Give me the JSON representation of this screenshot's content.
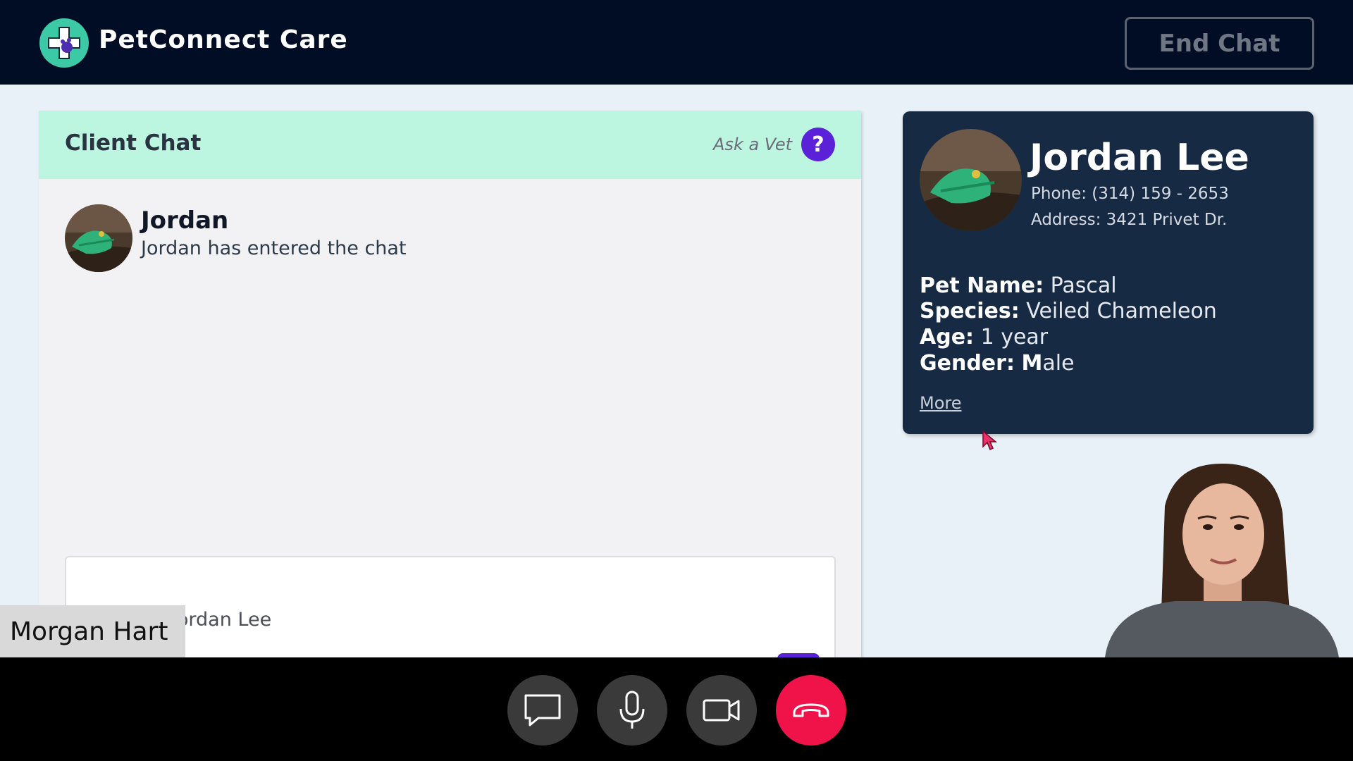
{
  "header": {
    "brand_name": "PetConnect Care",
    "end_chat_label": "End Chat"
  },
  "chat": {
    "title": "Client Chat",
    "ask_vet_label": "Ask a Vet",
    "help_symbol": "?",
    "messages": [
      {
        "sender": "Jordan",
        "text": "Jordan has entered the chat"
      }
    ],
    "input_placeholder": "Message Jordan Lee"
  },
  "profile": {
    "name": "Jordan Lee",
    "phone": "Phone: (314) 159 - 2653",
    "address": "Address: 3421 Privet Dr.",
    "pet_name_label": "Pet Name:",
    "pet_name": "Pascal",
    "species_label": "Species:",
    "species": "Veiled Chameleon",
    "age_label": "Age:",
    "age": "1 year",
    "gender_label": "Gender:",
    "gender_bold": "M",
    "gender_rest": "ale",
    "more_label": "More"
  },
  "video": {
    "participant_name": "Morgan Hart"
  },
  "controls": {
    "icons": [
      "chat-icon",
      "microphone-icon",
      "camera-icon",
      "hang-up-icon"
    ]
  },
  "colors": {
    "header_bg": "#010d24",
    "accent_purple": "#5b21d8",
    "chat_header_bg": "#bcf5e0",
    "profile_card_bg": "#172a44",
    "end_call_red": "#f0134a"
  }
}
